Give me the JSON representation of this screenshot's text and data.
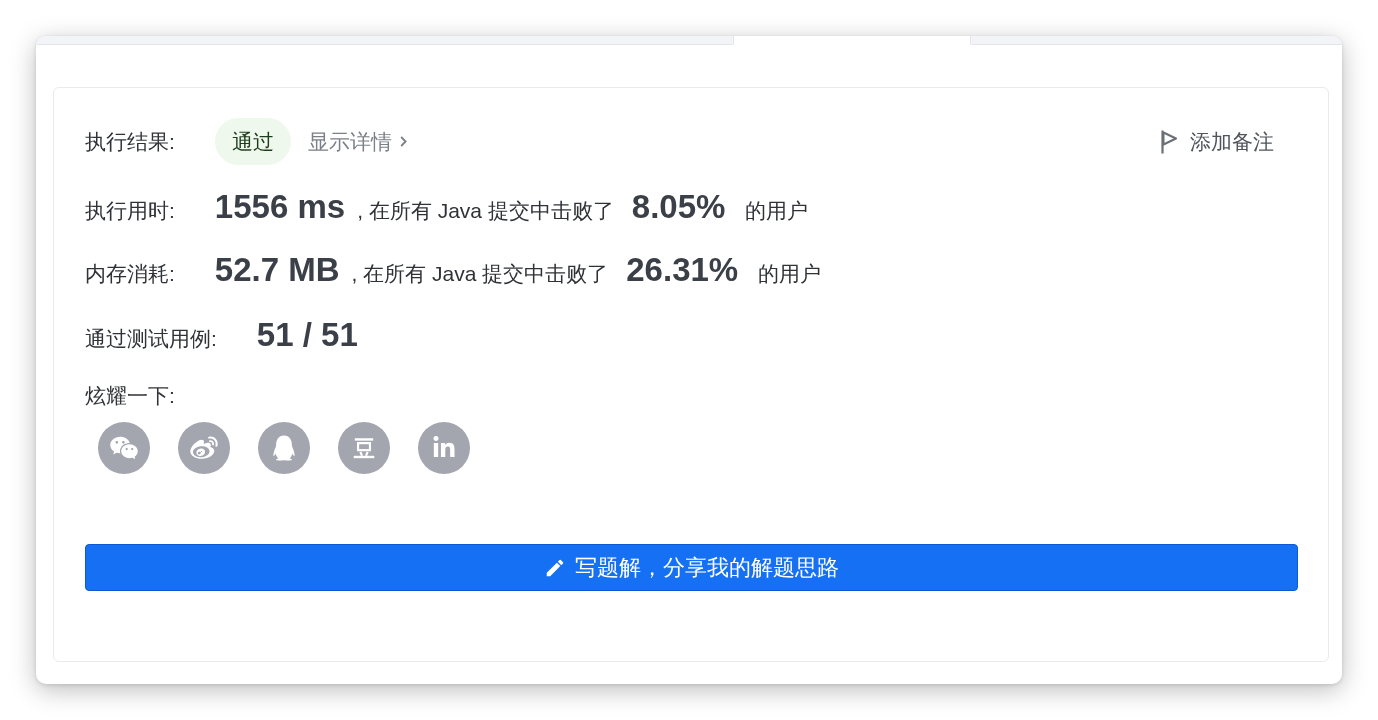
{
  "tabs": [
    {
      "selected": false
    },
    {
      "selected": true
    },
    {
      "selected": false
    }
  ],
  "result": {
    "label": "执行结果:",
    "status": {
      "text": "通过",
      "kind": "accepted"
    },
    "details_link": "显示详情",
    "note_button": "添加备注"
  },
  "stats": [
    {
      "label": "执行用时:",
      "value": "1556 ms",
      "text": ", 在所有 Java 提交中击败了",
      "percent": "8.05%",
      "suffix": "的用户"
    },
    {
      "label": "内存消耗:",
      "value": "52.7 MB",
      "text": ", 在所有 Java 提交中击败了",
      "percent": "26.31%",
      "suffix": "的用户"
    }
  ],
  "test_cases": {
    "label": "通过测试用例:",
    "value": "51 / 51"
  },
  "share": {
    "label": "炫耀一下:"
  },
  "solution_button": "写题解，分享我的解题思路"
}
